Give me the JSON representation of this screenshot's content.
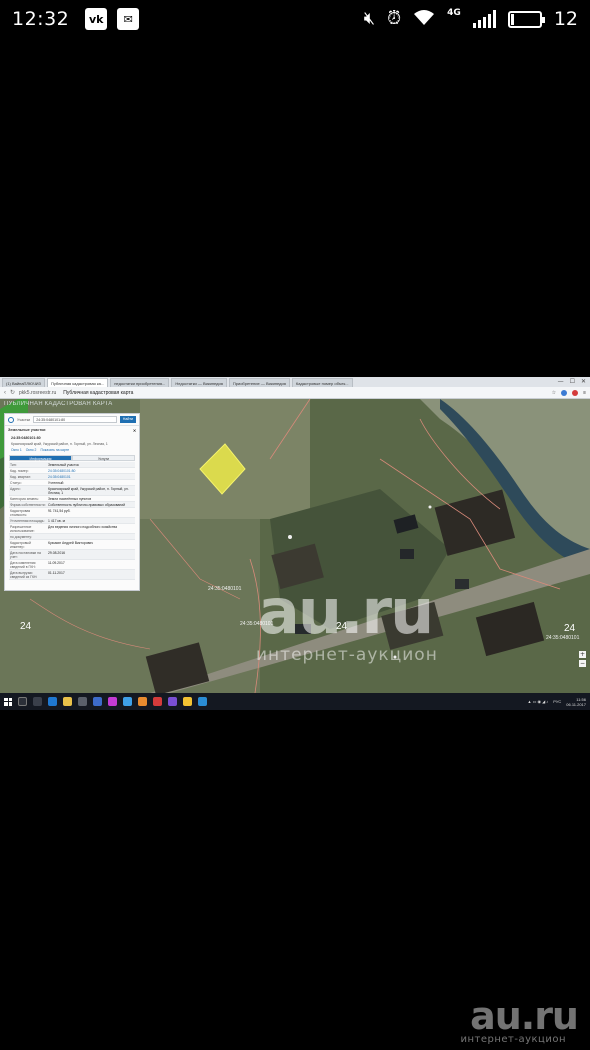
{
  "status_bar": {
    "time": "12:32",
    "left_icons": [
      "vk-icon",
      "mail-icon"
    ],
    "right_icons": [
      "mute-icon",
      "alarm-icon",
      "wifi-icon",
      "signal-icon",
      "battery-icon"
    ],
    "network_type": "4G",
    "battery_level": "12"
  },
  "browser": {
    "tabs": [
      {
        "label": "(1) ВайнаПЛЮЧИЗ",
        "active": false
      },
      {
        "label": "Публичная кадастровая ка...",
        "active": true
      },
      {
        "label": "недостатки приобретения...",
        "active": false
      },
      {
        "label": "Недостатки — Википедия",
        "active": false
      },
      {
        "label": "Приобретение — Википедия",
        "active": false
      },
      {
        "label": "Кадастровые номер объек...",
        "active": false
      }
    ],
    "address": {
      "url": "pkk5.rosreestr.ru",
      "page_title": "Публичная кадастровая карта"
    }
  },
  "map": {
    "title": "ПУБЛИЧНАЯ КАДАСТРОВАЯ КАРТА",
    "labels": [
      {
        "text": "24",
        "size": "big"
      },
      {
        "text": "24",
        "size": "big"
      },
      {
        "text": "24",
        "size": "big"
      },
      {
        "text": "24:35:0480101",
        "size": "small"
      },
      {
        "text": "24:35:0480101",
        "size": "small"
      },
      {
        "text": "24:35:0480101",
        "size": "small"
      }
    ],
    "zoom_in": "+",
    "zoom_out": "−"
  },
  "panel": {
    "search": {
      "type_label": "Участки",
      "value": "24:35:0480101:80",
      "button": "Найти"
    },
    "heading": "Земельные участки",
    "cadastral_number": "24:35:0480101:80",
    "address_text": "Красноярский край, Ужурский район, п. Горный, ул. Лесная, 1",
    "links": [
      "Окно 1",
      "Окно 2",
      "Показать на карте"
    ],
    "tabs": {
      "info": "Информация",
      "services": "Услуги"
    },
    "rows": [
      {
        "key": "Тип:",
        "value": "Земельный участок",
        "link": false
      },
      {
        "key": "Кад. номер:",
        "value": "24:35:0480101:80",
        "link": true
      },
      {
        "key": "Кад. квартал:",
        "value": "24:35:0480101",
        "link": true
      },
      {
        "key": "Статус:",
        "value": "Учтенный",
        "link": false
      },
      {
        "key": "Адрес:",
        "value": "Красноярский край, Ужурский район, п. Горный, ул. Лесная, 1",
        "link": false
      },
      {
        "key": "Категория земель:",
        "value": "Земли населённых пунктов",
        "link": false
      },
      {
        "key": "Форма собственности:",
        "value": "Собственность публично-правовых образований",
        "link": false
      },
      {
        "key": "Кадастровая стоимость:",
        "value": "91 741,54 руб.",
        "link": false
      },
      {
        "key": "Уточненная площадь:",
        "value": "1 417 кв. м",
        "link": false
      },
      {
        "key": "Разрешенное использование:",
        "value": "Для ведения личного подсобного хозяйства",
        "link": false
      },
      {
        "key": "по документу:",
        "value": "",
        "link": false
      },
      {
        "key": "Кадастровый инженер:",
        "value": "Кузьмин Андрей Викторович",
        "link": false
      },
      {
        "key": "Дата постановки на учет:",
        "value": "29.08.2016",
        "link": false
      },
      {
        "key": "Дата изменения сведений в ГКН:",
        "value": "11.09.2017",
        "link": false
      },
      {
        "key": "Дата выгрузки сведений из ГКН:",
        "value": "01.11.2017",
        "link": false
      }
    ]
  },
  "watermark": {
    "brand": "au.ru",
    "tagline": "интернет-аукцион"
  },
  "taskbar": {
    "clock_time": "11:56",
    "clock_date": "06.11.2017",
    "lang": "РУС"
  },
  "bottom_watermark": {
    "brand": "au.ru",
    "tagline": "интернет-аукцион"
  }
}
